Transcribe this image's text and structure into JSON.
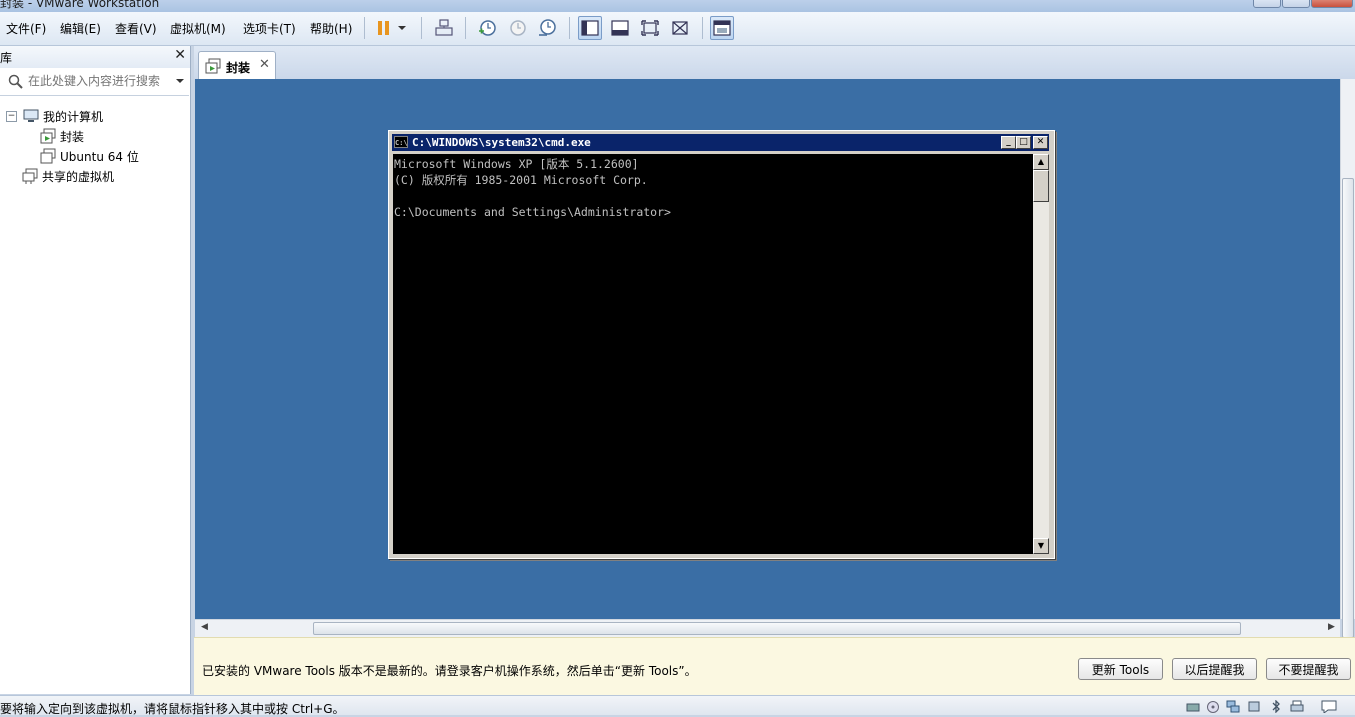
{
  "window": {
    "title": "封装 - VMware Workstation"
  },
  "menu": [
    "文件(F)",
    "编辑(E)",
    "查看(V)",
    "虚拟机(M)",
    "选项卡(T)",
    "帮助(H)"
  ],
  "toolbar": {
    "icons": [
      "pause-icon",
      "dropdown-arrow-icon",
      "send-ctrl-alt-del-icon",
      "snapshot-take-icon",
      "snapshot-revert-icon",
      "snapshot-manager-icon",
      "show-library-icon",
      "quick-switch-icon",
      "full-screen-icon",
      "unity-icon",
      "console-view-icon"
    ]
  },
  "library": {
    "title": "库",
    "search_placeholder": "在此处键入内容进行搜索",
    "tree": {
      "my_computer": "我的计算机",
      "vm1": "封装",
      "vm2": "Ubuntu 64 位",
      "shared": "共享的虚拟机"
    }
  },
  "tabs": [
    {
      "label": "封装",
      "active": true
    }
  ],
  "guest": {
    "desktop_color": "#3a6ea5",
    "cmd": {
      "title": "C:\\WINDOWS\\system32\\cmd.exe",
      "lines": [
        "Microsoft Windows XP [版本 5.1.2600]",
        "(C) 版权所有 1985-2001 Microsoft Corp.",
        "",
        "C:\\Documents and Settings\\Administrator>"
      ]
    }
  },
  "notification": {
    "message": "已安装的 VMware Tools 版本不是最新的。请登录客户机操作系统，然后单击“更新 Tools”。",
    "buttons": [
      "更新 Tools",
      "以后提醒我",
      "不要提醒我"
    ]
  },
  "status": {
    "message": "要将输入定向到该虚拟机，请将鼠标指针移入其中或按 Ctrl+G。"
  }
}
